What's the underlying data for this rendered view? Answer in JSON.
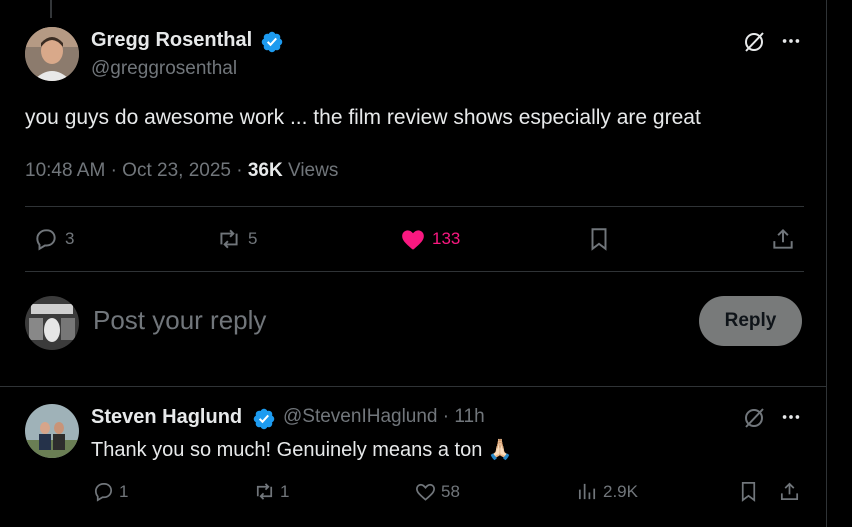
{
  "main_tweet": {
    "author_name": "Gregg Rosenthal",
    "author_handle": "@greggrosenthal",
    "text": "you guys do awesome work ... the film review shows especially are great",
    "time": "10:48 AM",
    "date": "Oct 23, 2025",
    "views_count": "36K",
    "views_label": "Views",
    "replies": "3",
    "reposts": "5",
    "likes": "133"
  },
  "reply_box": {
    "placeholder": "Post your reply",
    "button_label": "Reply"
  },
  "reply_tweet": {
    "author_name": "Steven Haglund",
    "author_handle": "@StevenIHaglund",
    "age": "11h",
    "text": "Thank you so much! Genuinely means a ton",
    "emoji": "🙏🏻",
    "replies": "1",
    "reposts": "1",
    "likes": "58",
    "views": "2.9K"
  },
  "colors": {
    "like_active": "#f91880",
    "verified": "#1d9bf0",
    "muted": "#71767b"
  }
}
